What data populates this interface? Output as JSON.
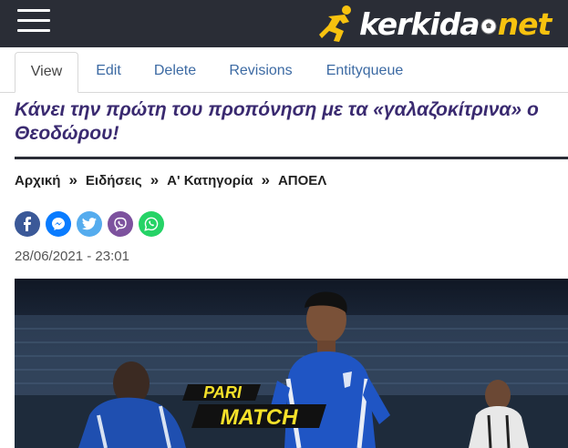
{
  "header": {
    "menu_icon": "hamburger-menu-icon",
    "logo_text_main": "kerkida",
    "logo_text_tld": "net",
    "colors": {
      "bar": "#2a2d36",
      "logo_accent": "#f7c20f"
    }
  },
  "tabs": [
    {
      "label": "View",
      "active": true
    },
    {
      "label": "Edit",
      "active": false
    },
    {
      "label": "Delete",
      "active": false
    },
    {
      "label": "Revisions",
      "active": false
    },
    {
      "label": "Entityqueue",
      "active": false
    }
  ],
  "article": {
    "title": "Κάνει την πρώτη του προπόνηση με τα «γαλαζοκίτρινα» ο Θεοδώρου!",
    "title_color": "#3a2a70",
    "breadcrumb": [
      "Αρχική",
      "Ειδήσεις",
      "Α' Κατηγορία",
      "ΑΠΟΕΛ"
    ],
    "breadcrumb_separator": "»",
    "share_icons": [
      "facebook-icon",
      "messenger-icon",
      "twitter-icon",
      "viber-icon",
      "whatsapp-icon"
    ],
    "date": "28/06/2021 - 23:01",
    "photo_sponsor_top": "PARI",
    "photo_sponsor_bottom": "MATCH"
  }
}
